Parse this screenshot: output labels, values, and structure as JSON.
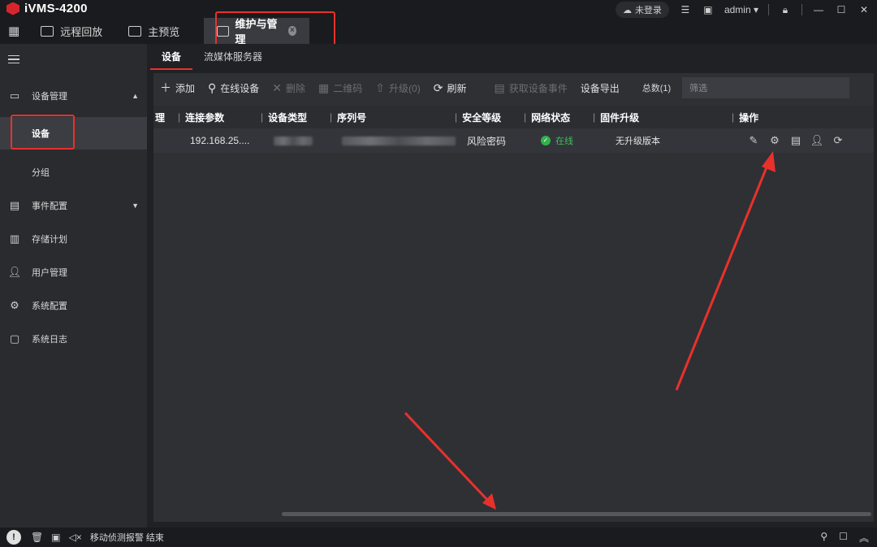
{
  "app": {
    "title": "iVMS-4200"
  },
  "window": {
    "login_label": "未登录",
    "user": "admin"
  },
  "tabs": [
    {
      "label": "远程回放"
    },
    {
      "label": "主预览"
    },
    {
      "label": "维护与管理"
    }
  ],
  "sidebar": {
    "items": [
      {
        "label": "设备管理",
        "icon": "device-icon"
      },
      {
        "label": "设备"
      },
      {
        "label": "分组"
      },
      {
        "label": "事件配置",
        "icon": "event-icon"
      },
      {
        "label": "存储计划",
        "icon": "storage-icon"
      },
      {
        "label": "用户管理",
        "icon": "user-icon"
      },
      {
        "label": "系统配置",
        "icon": "settings-icon"
      },
      {
        "label": "系统日志",
        "icon": "log-icon"
      }
    ]
  },
  "subtabs": [
    {
      "label": "设备"
    },
    {
      "label": "流媒体服务器"
    }
  ],
  "toolbar": {
    "add": "添加",
    "online_devices": "在线设备",
    "delete": "删除",
    "qrcode": "二维码",
    "upgrade": "升级(0)",
    "refresh": "刷新",
    "get_events": "获取设备事件",
    "export": "设备导出",
    "total": "总数(1)",
    "filter_placeholder": "筛选"
  },
  "table": {
    "headers": [
      "理",
      "连接参数",
      "设备类型",
      "序列号",
      "安全等级",
      "网络状态",
      "固件升级",
      "操作"
    ],
    "rows": [
      {
        "connection": "192.168.25....",
        "security": "风险密码",
        "status": "在线",
        "firmware": "无升级版本"
      }
    ]
  },
  "statusbar": {
    "message": "移动侦测报警 结束"
  },
  "colors": {
    "accent": "#e8312c",
    "online": "#2fb34a",
    "brand": "#d7262b"
  }
}
